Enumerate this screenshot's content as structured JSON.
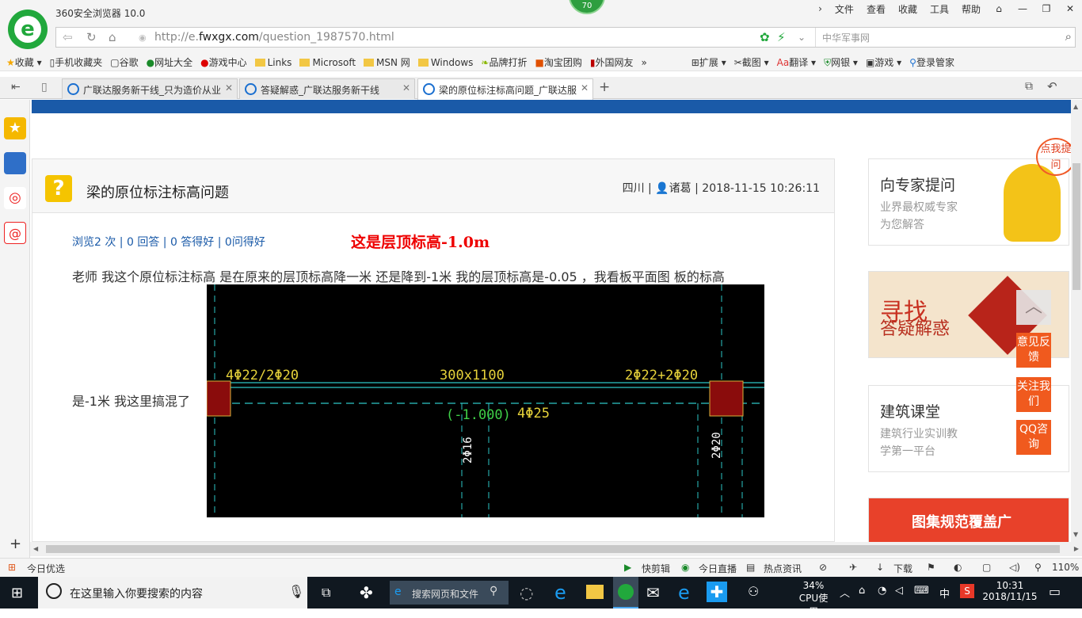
{
  "browser": {
    "app_title": "360安全浏览器 10.0",
    "badge": "70",
    "menu": [
      "文件",
      "查看",
      "收藏",
      "工具",
      "帮助"
    ],
    "url_prefix": "http://e.",
    "url_host": "fwxgx.com",
    "url_path": "/question_1987570.html",
    "search_placeholder": "中华军事网"
  },
  "bookmarks": [
    "收藏",
    "手机收藏夹",
    "谷歌",
    "网址大全",
    "游戏中心",
    "Links",
    "Microsoft",
    "MSN 网",
    "Windows",
    "品牌打折",
    "淘宝团购",
    "外国网友"
  ],
  "toolbar_right": [
    "扩展",
    "截图",
    "翻译",
    "网银",
    "游戏",
    "登录管家"
  ],
  "tabs": [
    {
      "label": "广联达服务新干线_只为造价从业"
    },
    {
      "label": "答疑解惑_广联达服务新干线"
    },
    {
      "label": "梁的原位标注标高问题_广联达服"
    }
  ],
  "question": {
    "title": "梁的原位标注标高问题",
    "region": "四川",
    "author": "诸葛",
    "datetime": "2018-11-15 10:26:11",
    "stats": "浏览2 次 | 0 回答 | 0 答得好 | 0问得好",
    "highlight": "这是层顶标高-1.0m",
    "body_line1": "老师  我这个原位标注标高 是在原来的层顶标高降一米  还是降到-1米  我的层顶标高是-0.05   ，我看板平面图  板的标高",
    "body_line2": "是-1米 我这里搞混了"
  },
  "cad": {
    "left_rebar": "4Φ22/2Φ20",
    "section": "300x1100",
    "right_rebar": "2Φ22+2Φ20",
    "elevation": "(-1.000)",
    "bottom_rebar": "4Φ25",
    "stirrup_left": "2Φ16",
    "stirrup_right": "2Φ20"
  },
  "sidebar_cards": [
    {
      "title": "向专家提问",
      "line1": "业界最权威专家",
      "line2": "为您解答"
    },
    {
      "title": "寻找",
      "subtitle": "答疑解惑"
    },
    {
      "title": "建筑课堂",
      "line1": "建筑行业实训教",
      "line2": "学第一平台"
    },
    {
      "title": "图集规范覆盖广"
    }
  ],
  "float_buttons": [
    "意见反馈",
    "关注我们",
    "QQ咨询"
  ],
  "ask_badge": "点我提问",
  "statusbar": {
    "left": "今日优选",
    "items": [
      "快剪辑",
      "今日直播",
      "热点资讯",
      "下载"
    ],
    "zoom": "110%"
  },
  "taskbar": {
    "search_placeholder": "在这里输入你要搜索的内容",
    "web_search": "搜索网页和文件",
    "cpu_percent": "34%",
    "cpu_label": "CPU使用",
    "ime": "中",
    "time": "10:31",
    "date": "2018/11/15"
  },
  "colors": {
    "accent": "#1a5aa8",
    "brand_green": "#21a83c",
    "highlight_red": "#e00000",
    "orange": "#f0551e"
  }
}
